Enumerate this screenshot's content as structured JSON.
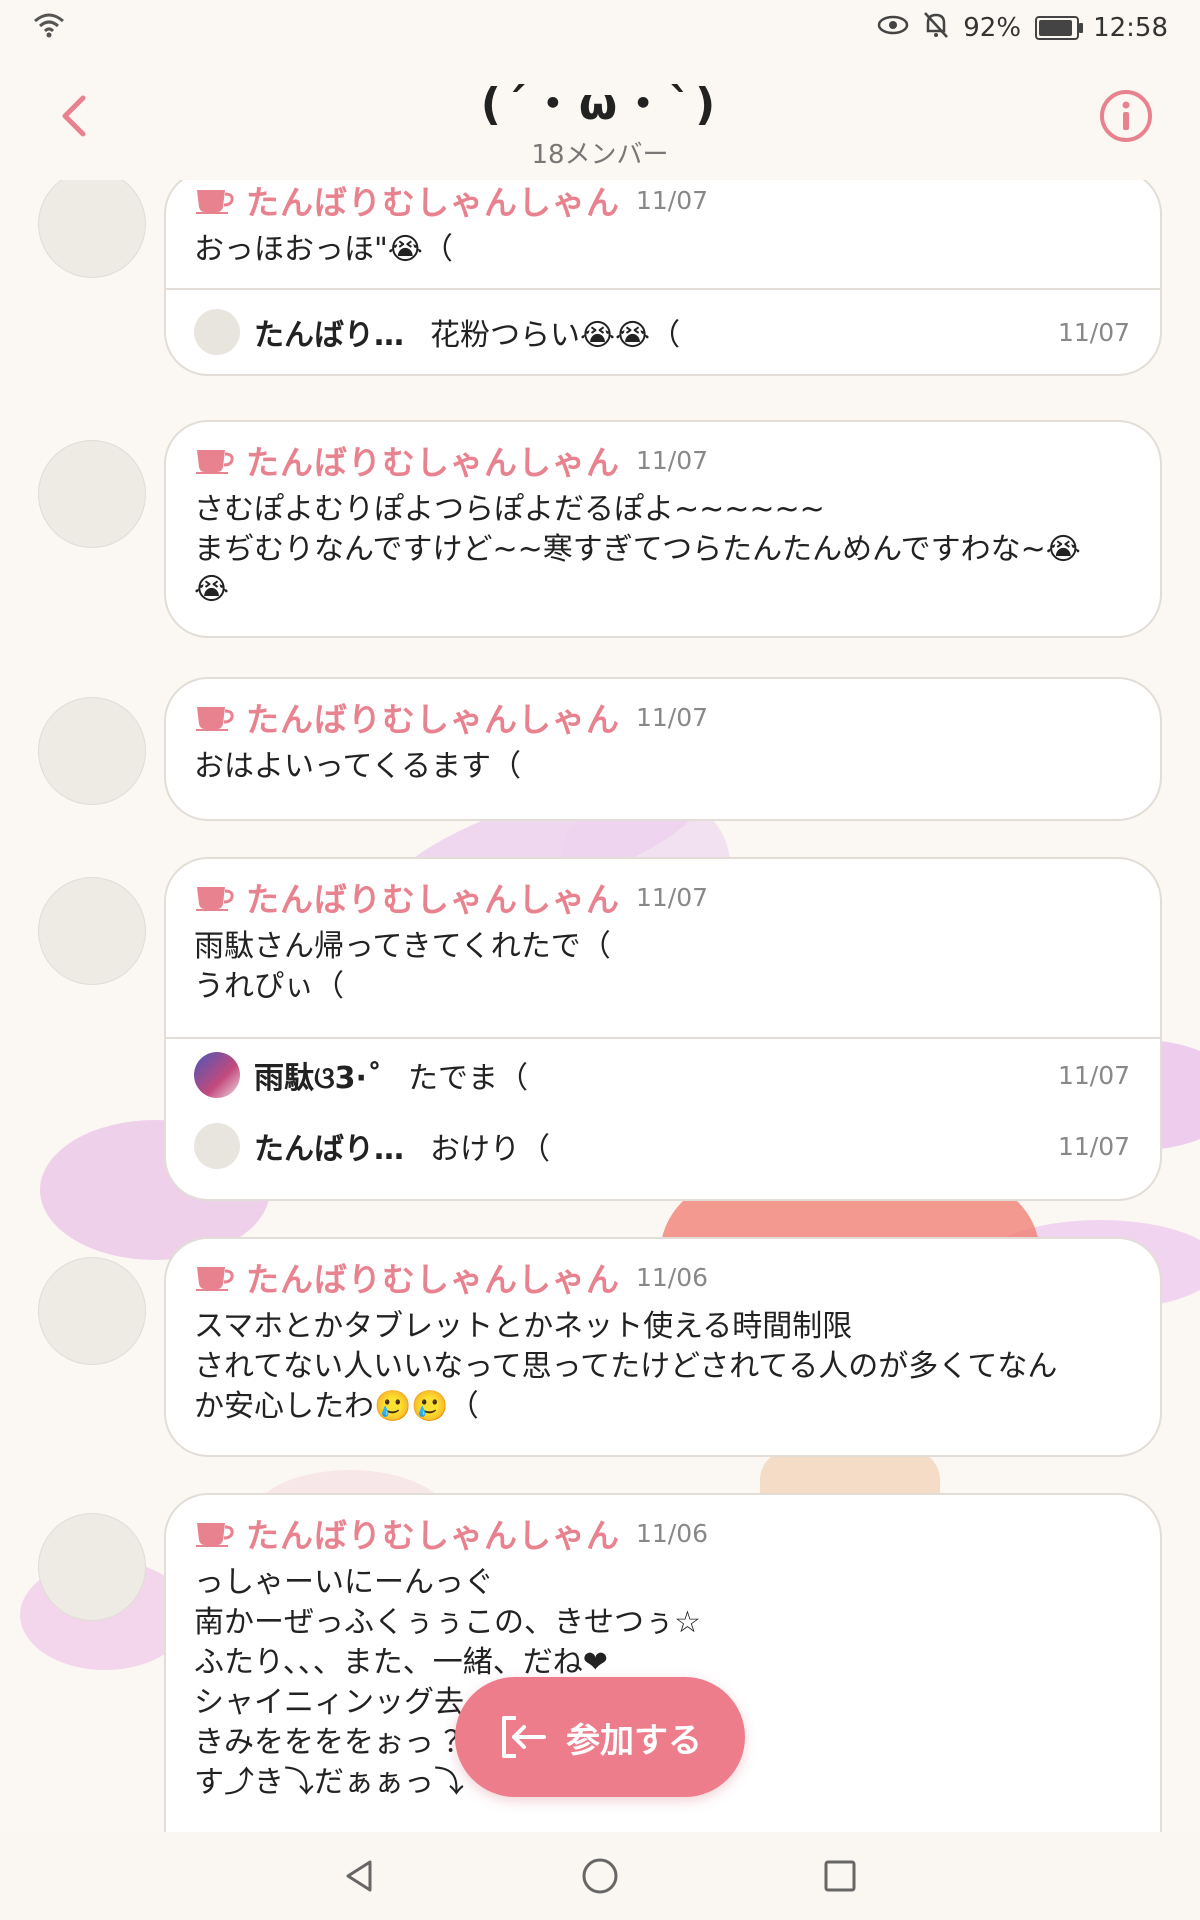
{
  "status_bar": {
    "battery": "92%",
    "time": "12:58",
    "battery_level": 0.92,
    "icons": [
      "wifi-icon",
      "eye-icon",
      "bell-off-icon",
      "battery-icon"
    ]
  },
  "header": {
    "title": "(´・ω・`)",
    "members": "18メンバー",
    "accent": "#e8828f"
  },
  "messages": [
    {
      "sender": "たんばりむしゃんしゃん",
      "date": "11/07",
      "text": "おっほおっほ\"😭（",
      "replies": [
        {
          "name": "たんばり…",
          "text": "花粉つらい😭😭（",
          "date": "11/07"
        }
      ]
    },
    {
      "sender": "たんばりむしゃんしゃん",
      "date": "11/07",
      "text": "さむぽよむりぽよつらぽよだるぽよ~~~~~~\nまぢむりなんですけど~~寒すぎてつらたんたんめんですわな~😭\n😭",
      "replies": []
    },
    {
      "sender": "たんばりむしゃんしゃん",
      "date": "11/07",
      "text": "おはよいってくるます（",
      "replies": []
    },
    {
      "sender": "たんばりむしゃんしゃん",
      "date": "11/07",
      "text": "雨駄さん帰ってきてくれたで（\nうれぴぃ（",
      "replies": [
        {
          "name": "雨駄ଓ3·˚",
          "text": "たでま（",
          "date": "11/07"
        },
        {
          "name": "たんばり…",
          "text": "おけり（",
          "date": "11/07"
        }
      ]
    },
    {
      "sender": "たんばりむしゃんしゃん",
      "date": "11/06",
      "text": "スマホとかタブレットとかネット使える時間制限\nされてない人いいなって思ってたけどされてる人のが多くてなん\nか安心したわ🥲🥲（",
      "replies": []
    },
    {
      "sender": "たんばりむしゃんしゃん",
      "date": "11/06",
      "text": "っしゃーいにーんっぐ\n南かーぜっふくぅぅこの、きせつぅ☆\nふたり、、、また、一緒、だね❤\nシャイニィンッグ去                        ぃーーー\nきみををををぉっ                           ？！！！\nす⤴き⤵だぁぁっ⤵",
      "replies": []
    }
  ],
  "join_button": {
    "label": "参加する"
  },
  "nav": {
    "icons": [
      "back-triangle-icon",
      "home-circle-icon",
      "recents-square-icon"
    ]
  }
}
